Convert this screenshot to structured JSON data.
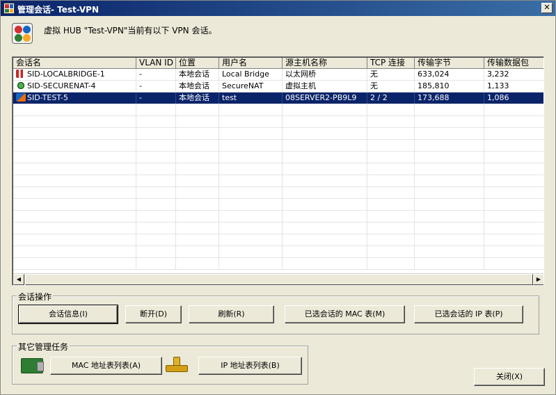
{
  "window": {
    "title": "管理会话- Test-VPN",
    "close_glyph": "✕"
  },
  "header": {
    "text": "虚拟 HUB \"Test-VPN\"当前有以下 VPN 会话。"
  },
  "table": {
    "columns": [
      "会话名",
      "VLAN ID",
      "位置",
      "用户名",
      "源主机名称",
      "TCP 连接",
      "传输字节",
      "传输数据包"
    ],
    "rows": [
      {
        "icon": "bridge-icon",
        "session": "SID-LOCALBRIDGE-1",
        "vlan": "-",
        "location": "本地会话",
        "user": "Local Bridge",
        "host": "以太网桥",
        "tcp": "无",
        "bytes": "633,024",
        "packets": "3,232"
      },
      {
        "icon": "securenat-icon",
        "session": "SID-SECURENAT-4",
        "vlan": "-",
        "location": "本地会话",
        "user": "SecureNAT",
        "host": "虚拟主机",
        "tcp": "无",
        "bytes": "185,810",
        "packets": "1,133"
      },
      {
        "icon": "user-session-icon",
        "session": "SID-TEST-5",
        "vlan": "-",
        "location": "本地会话",
        "user": "test",
        "host": "08SERVER2-PB9L9",
        "tcp": "2 / 2",
        "bytes": "173,688",
        "packets": "1,086"
      }
    ]
  },
  "session_ops": {
    "label": "会话操作",
    "info": "会话信息(I)",
    "disconnect": "断开(D)",
    "refresh": "刷新(R)",
    "mac_table": "已选会话的 MAC 表(M)",
    "ip_table": "已选会话的 IP 表(P)"
  },
  "other_tasks": {
    "label": "其它管理任务",
    "mac_list": "MAC 地址表列表(A)",
    "ip_list": "IP 地址表列表(B)"
  },
  "close_button": "关闭(X)",
  "colors": {
    "selection": "#0a246a",
    "titlebar": "#0a246a",
    "face": "#ece9d8"
  }
}
